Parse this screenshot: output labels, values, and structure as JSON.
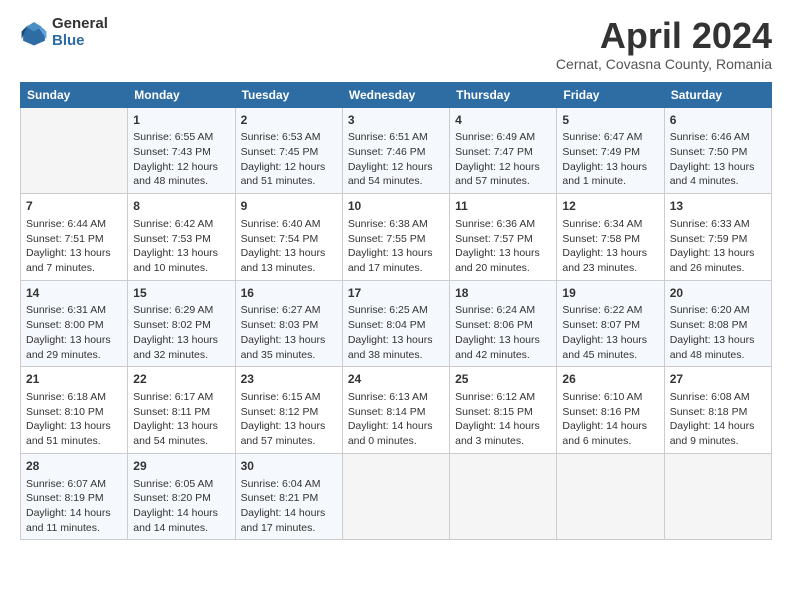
{
  "header": {
    "logo_general": "General",
    "logo_blue": "Blue",
    "title": "April 2024",
    "subtitle": "Cernat, Covasna County, Romania"
  },
  "days_of_week": [
    "Sunday",
    "Monday",
    "Tuesday",
    "Wednesday",
    "Thursday",
    "Friday",
    "Saturday"
  ],
  "weeks": [
    [
      {
        "day": "",
        "empty": true
      },
      {
        "day": "1",
        "sunrise": "Sunrise: 6:55 AM",
        "sunset": "Sunset: 7:43 PM",
        "daylight": "Daylight: 12 hours and 48 minutes."
      },
      {
        "day": "2",
        "sunrise": "Sunrise: 6:53 AM",
        "sunset": "Sunset: 7:45 PM",
        "daylight": "Daylight: 12 hours and 51 minutes."
      },
      {
        "day": "3",
        "sunrise": "Sunrise: 6:51 AM",
        "sunset": "Sunset: 7:46 PM",
        "daylight": "Daylight: 12 hours and 54 minutes."
      },
      {
        "day": "4",
        "sunrise": "Sunrise: 6:49 AM",
        "sunset": "Sunset: 7:47 PM",
        "daylight": "Daylight: 12 hours and 57 minutes."
      },
      {
        "day": "5",
        "sunrise": "Sunrise: 6:47 AM",
        "sunset": "Sunset: 7:49 PM",
        "daylight": "Daylight: 13 hours and 1 minute."
      },
      {
        "day": "6",
        "sunrise": "Sunrise: 6:46 AM",
        "sunset": "Sunset: 7:50 PM",
        "daylight": "Daylight: 13 hours and 4 minutes."
      }
    ],
    [
      {
        "day": "7",
        "sunrise": "Sunrise: 6:44 AM",
        "sunset": "Sunset: 7:51 PM",
        "daylight": "Daylight: 13 hours and 7 minutes."
      },
      {
        "day": "8",
        "sunrise": "Sunrise: 6:42 AM",
        "sunset": "Sunset: 7:53 PM",
        "daylight": "Daylight: 13 hours and 10 minutes."
      },
      {
        "day": "9",
        "sunrise": "Sunrise: 6:40 AM",
        "sunset": "Sunset: 7:54 PM",
        "daylight": "Daylight: 13 hours and 13 minutes."
      },
      {
        "day": "10",
        "sunrise": "Sunrise: 6:38 AM",
        "sunset": "Sunset: 7:55 PM",
        "daylight": "Daylight: 13 hours and 17 minutes."
      },
      {
        "day": "11",
        "sunrise": "Sunrise: 6:36 AM",
        "sunset": "Sunset: 7:57 PM",
        "daylight": "Daylight: 13 hours and 20 minutes."
      },
      {
        "day": "12",
        "sunrise": "Sunrise: 6:34 AM",
        "sunset": "Sunset: 7:58 PM",
        "daylight": "Daylight: 13 hours and 23 minutes."
      },
      {
        "day": "13",
        "sunrise": "Sunrise: 6:33 AM",
        "sunset": "Sunset: 7:59 PM",
        "daylight": "Daylight: 13 hours and 26 minutes."
      }
    ],
    [
      {
        "day": "14",
        "sunrise": "Sunrise: 6:31 AM",
        "sunset": "Sunset: 8:00 PM",
        "daylight": "Daylight: 13 hours and 29 minutes."
      },
      {
        "day": "15",
        "sunrise": "Sunrise: 6:29 AM",
        "sunset": "Sunset: 8:02 PM",
        "daylight": "Daylight: 13 hours and 32 minutes."
      },
      {
        "day": "16",
        "sunrise": "Sunrise: 6:27 AM",
        "sunset": "Sunset: 8:03 PM",
        "daylight": "Daylight: 13 hours and 35 minutes."
      },
      {
        "day": "17",
        "sunrise": "Sunrise: 6:25 AM",
        "sunset": "Sunset: 8:04 PM",
        "daylight": "Daylight: 13 hours and 38 minutes."
      },
      {
        "day": "18",
        "sunrise": "Sunrise: 6:24 AM",
        "sunset": "Sunset: 8:06 PM",
        "daylight": "Daylight: 13 hours and 42 minutes."
      },
      {
        "day": "19",
        "sunrise": "Sunrise: 6:22 AM",
        "sunset": "Sunset: 8:07 PM",
        "daylight": "Daylight: 13 hours and 45 minutes."
      },
      {
        "day": "20",
        "sunrise": "Sunrise: 6:20 AM",
        "sunset": "Sunset: 8:08 PM",
        "daylight": "Daylight: 13 hours and 48 minutes."
      }
    ],
    [
      {
        "day": "21",
        "sunrise": "Sunrise: 6:18 AM",
        "sunset": "Sunset: 8:10 PM",
        "daylight": "Daylight: 13 hours and 51 minutes."
      },
      {
        "day": "22",
        "sunrise": "Sunrise: 6:17 AM",
        "sunset": "Sunset: 8:11 PM",
        "daylight": "Daylight: 13 hours and 54 minutes."
      },
      {
        "day": "23",
        "sunrise": "Sunrise: 6:15 AM",
        "sunset": "Sunset: 8:12 PM",
        "daylight": "Daylight: 13 hours and 57 minutes."
      },
      {
        "day": "24",
        "sunrise": "Sunrise: 6:13 AM",
        "sunset": "Sunset: 8:14 PM",
        "daylight": "Daylight: 14 hours and 0 minutes."
      },
      {
        "day": "25",
        "sunrise": "Sunrise: 6:12 AM",
        "sunset": "Sunset: 8:15 PM",
        "daylight": "Daylight: 14 hours and 3 minutes."
      },
      {
        "day": "26",
        "sunrise": "Sunrise: 6:10 AM",
        "sunset": "Sunset: 8:16 PM",
        "daylight": "Daylight: 14 hours and 6 minutes."
      },
      {
        "day": "27",
        "sunrise": "Sunrise: 6:08 AM",
        "sunset": "Sunset: 8:18 PM",
        "daylight": "Daylight: 14 hours and 9 minutes."
      }
    ],
    [
      {
        "day": "28",
        "sunrise": "Sunrise: 6:07 AM",
        "sunset": "Sunset: 8:19 PM",
        "daylight": "Daylight: 14 hours and 11 minutes."
      },
      {
        "day": "29",
        "sunrise": "Sunrise: 6:05 AM",
        "sunset": "Sunset: 8:20 PM",
        "daylight": "Daylight: 14 hours and 14 minutes."
      },
      {
        "day": "30",
        "sunrise": "Sunrise: 6:04 AM",
        "sunset": "Sunset: 8:21 PM",
        "daylight": "Daylight: 14 hours and 17 minutes."
      },
      {
        "day": "",
        "empty": true
      },
      {
        "day": "",
        "empty": true
      },
      {
        "day": "",
        "empty": true
      },
      {
        "day": "",
        "empty": true
      }
    ]
  ]
}
